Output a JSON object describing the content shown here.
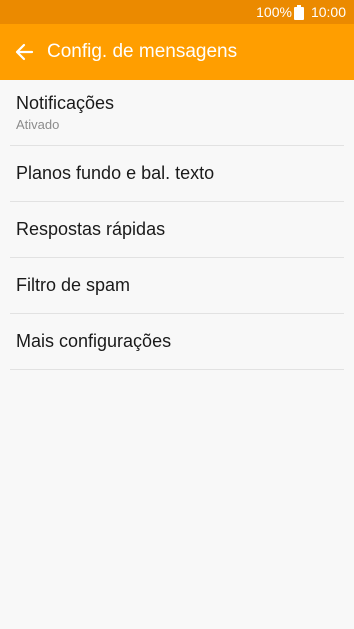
{
  "status_bar": {
    "battery_percent": "100%",
    "battery_icon": "battery-full-icon",
    "time": "10:00",
    "color": "#eb8a00"
  },
  "app_bar": {
    "back_icon": "arrow-left-icon",
    "title": "Config. de mensagens",
    "color": "#ff9e00"
  },
  "settings": {
    "items": [
      {
        "label": "Notificações",
        "subtitle": "Ativado"
      },
      {
        "label": "Planos fundo e bal. texto"
      },
      {
        "label": "Respostas rápidas"
      },
      {
        "label": "Filtro de spam"
      },
      {
        "label": "Mais configurações"
      }
    ]
  }
}
